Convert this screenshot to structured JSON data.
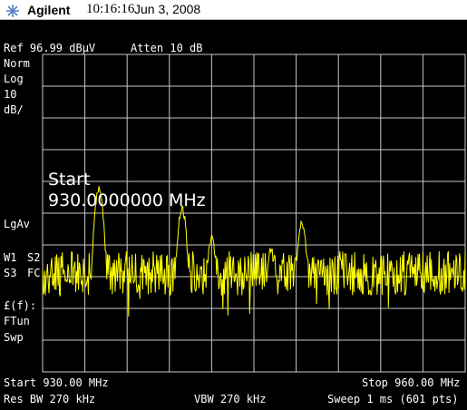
{
  "header": {
    "brand": "Agilent",
    "time": "10:16:16",
    "date": "Jun 3, 2008"
  },
  "analyzer": {
    "ref_level": "Ref 96.99 dBµV",
    "attenuation": "Atten 10 dB",
    "detector_norm": "Norm",
    "scale_type": "Log",
    "scale_value": "10",
    "scale_unit": "dB/",
    "averaging": "LgAv",
    "trace_w1": "W1",
    "trace_s2": "S2",
    "trace_s3": "S3",
    "trace_fc": "FC",
    "freq_corr": "£(f):",
    "ftun": "FTun",
    "swp": "Swp",
    "active_function_label": "Start",
    "active_function_value": "930.0000000 MHz",
    "start_freq": "Start 930.00 MHz",
    "stop_freq": "Stop 960.00 MHz",
    "res_bw": "Res BW 270 kHz",
    "vbw": "VBW 270 kHz",
    "sweep": "Sweep 1 ms (601 pts)",
    "trace_color": "#ffff00",
    "grid_color": "#c8c8c8"
  },
  "chart_data": {
    "type": "line",
    "x_range_mhz": [
      930,
      960
    ],
    "y_range_dbuv": [
      -3.01,
      96.99
    ],
    "points": 601,
    "noise_floor_dbuv": [
      21,
      35
    ],
    "peaks": [
      {
        "freq_mhz": 934.0,
        "level_dbuv": 56
      },
      {
        "freq_mhz": 939.9,
        "level_dbuv": 50
      },
      {
        "freq_mhz": 942.0,
        "level_dbuv": 41
      },
      {
        "freq_mhz": 946.2,
        "level_dbuv": 37
      },
      {
        "freq_mhz": 948.4,
        "level_dbuv": 46
      }
    ]
  }
}
